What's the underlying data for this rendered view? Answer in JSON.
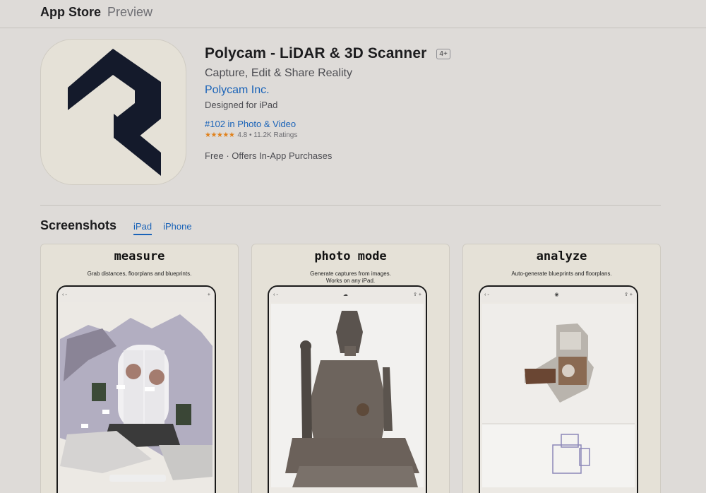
{
  "topbar": {
    "store": "App Store",
    "preview": "Preview"
  },
  "app": {
    "title": "Polycam - LiDAR & 3D Scanner",
    "age_rating": "4+",
    "subtitle": "Capture, Edit & Share Reality",
    "developer": "Polycam Inc.",
    "designed_for": "Designed for iPad",
    "rank": "#102 in Photo & Video",
    "stars": "★★★★★",
    "rating": "4.8",
    "ratings_count": "11.2K Ratings",
    "price": "Free · Offers In-App Purchases",
    "icon": "polycam-logo",
    "icon_color": "#141a2b"
  },
  "screenshots": {
    "title": "Screenshots",
    "tabs": [
      {
        "label": "iPad",
        "active": true
      },
      {
        "label": "iPhone",
        "active": false
      }
    ],
    "cards": [
      {
        "title": "measure",
        "subtitle_lines": [
          "Grab distances, floorplans and blueprints."
        ]
      },
      {
        "title": "photo mode",
        "subtitle_lines": [
          "Generate captures from images.",
          "Works on any iPad."
        ]
      },
      {
        "title": "analyze",
        "subtitle_lines": [
          "Auto-generate blueprints and floorplans."
        ]
      }
    ]
  },
  "colors": {
    "link": "#1a63b8",
    "background": "#dedbd8",
    "star": "#e0811b"
  }
}
